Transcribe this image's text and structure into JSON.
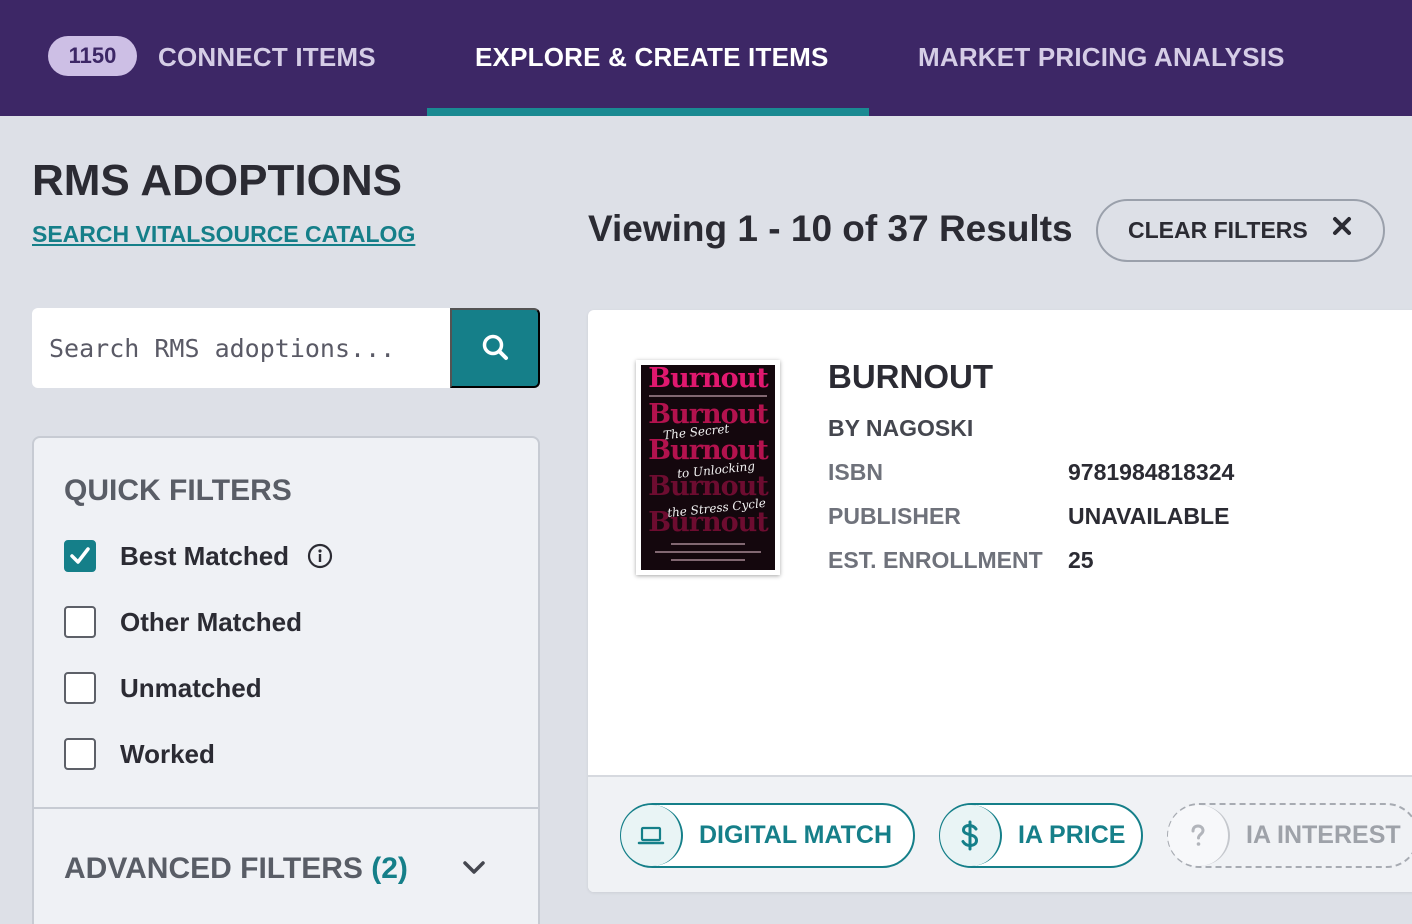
{
  "nav": {
    "badge_count": "1150",
    "tabs": [
      {
        "label": "CONNECT ITEMS",
        "active": false
      },
      {
        "label": "EXPLORE & CREATE ITEMS",
        "active": true
      },
      {
        "label": "MARKET PRICING ANALYSIS",
        "active": false
      }
    ]
  },
  "header": {
    "title": "RMS ADOPTIONS",
    "catalog_link": "SEARCH VITALSOURCE CATALOG",
    "results_text": "Viewing 1 - 10 of 37 Results",
    "clear_filters_label": "CLEAR FILTERS"
  },
  "search": {
    "placeholder": "Search RMS adoptions...",
    "value": ""
  },
  "filters": {
    "quick_title": "QUICK FILTERS",
    "items": [
      {
        "label": "Best Matched",
        "checked": true,
        "info": true
      },
      {
        "label": "Other Matched",
        "checked": false
      },
      {
        "label": "Unmatched",
        "checked": false
      },
      {
        "label": "Worked",
        "checked": false
      }
    ],
    "advanced_title": "ADVANCED FILTERS",
    "advanced_count": "(2)"
  },
  "result": {
    "title": "BURNOUT",
    "author": "BY NAGOSKI",
    "cover": {
      "word": "Burnout",
      "line1": "The Secret",
      "line2": "to Unlocking",
      "line3": "the Stress Cycle"
    },
    "meta": [
      {
        "label": "ISBN",
        "value": "9781984818324"
      },
      {
        "label": "PUBLISHER",
        "value": "UNAVAILABLE"
      },
      {
        "label": "EST. ENROLLMENT",
        "value": "25"
      }
    ],
    "actions": [
      {
        "label": "DIGITAL MATCH",
        "icon": "laptop-icon"
      },
      {
        "label": "IA PRICE",
        "icon": "dollar-icon"
      },
      {
        "label": "IA INTEREST",
        "icon": "question-icon"
      }
    ]
  },
  "colors": {
    "nav_bg": "#3d2766",
    "accent": "#157f89",
    "page_bg": "#dde0e7"
  }
}
